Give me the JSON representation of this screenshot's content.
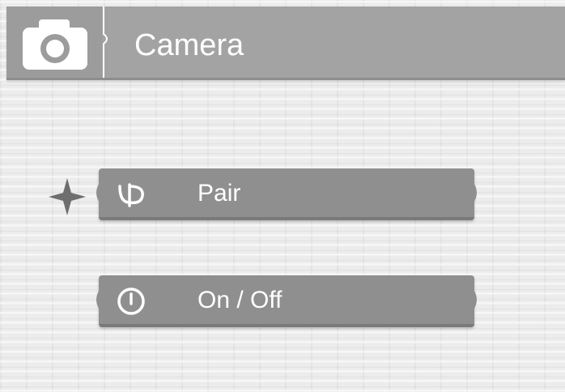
{
  "header": {
    "icon": "camera-icon",
    "title": "Camera"
  },
  "menu": {
    "selected_index": 0,
    "items": [
      {
        "icon": "pair-icon",
        "label": "Pair"
      },
      {
        "icon": "power-icon",
        "label": "On / Off"
      }
    ]
  },
  "colors": {
    "header_bg": "#a3a3a3",
    "item_bg": "#8f8f8f",
    "text": "#ffffff",
    "selector": "#6e6e6e"
  }
}
